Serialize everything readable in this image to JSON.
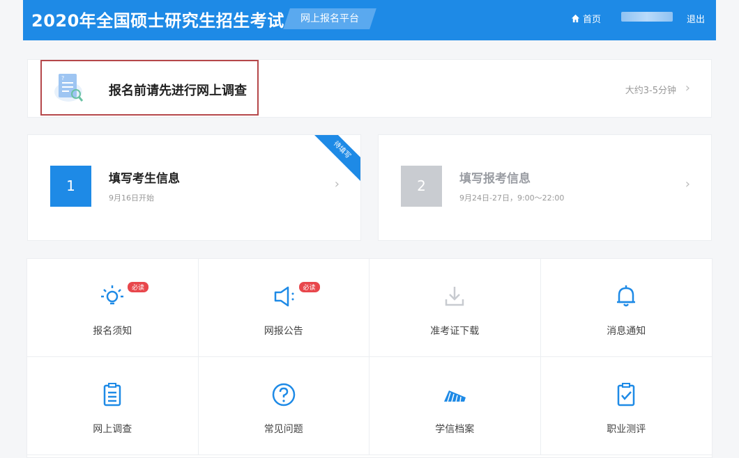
{
  "header": {
    "title": "2020年全国硕士研究生招生考试",
    "platform": "网上报名平台",
    "home": "首页",
    "logout": "退出"
  },
  "survey": {
    "label": "报名前请先进行网上调查",
    "time": "大约3-5分钟"
  },
  "steps": [
    {
      "num": "1",
      "title": "填写考生信息",
      "date": "9月16日开始",
      "ribbon": "待填写"
    },
    {
      "num": "2",
      "title": "填写报考信息",
      "date": "9月24日-27日，9:00～22:00"
    }
  ],
  "tiles": [
    {
      "label": "报名须知",
      "icon": "lightbulb-icon",
      "tag": "必读"
    },
    {
      "label": "网报公告",
      "icon": "megaphone-icon",
      "tag": "必读"
    },
    {
      "label": "准考证下载",
      "icon": "download-icon"
    },
    {
      "label": "消息通知",
      "icon": "bell-icon"
    },
    {
      "label": "网上调查",
      "icon": "clipboard-list-icon"
    },
    {
      "label": "常见问题",
      "icon": "question-icon"
    },
    {
      "label": "学信档案",
      "icon": "archive-icon"
    },
    {
      "label": "职业测评",
      "icon": "clipboard-check-icon"
    }
  ],
  "colors": {
    "primary": "#1e8ae6",
    "disabled": "#c9ccd1",
    "tag": "#e8474c",
    "highlight": "#b5474a"
  }
}
